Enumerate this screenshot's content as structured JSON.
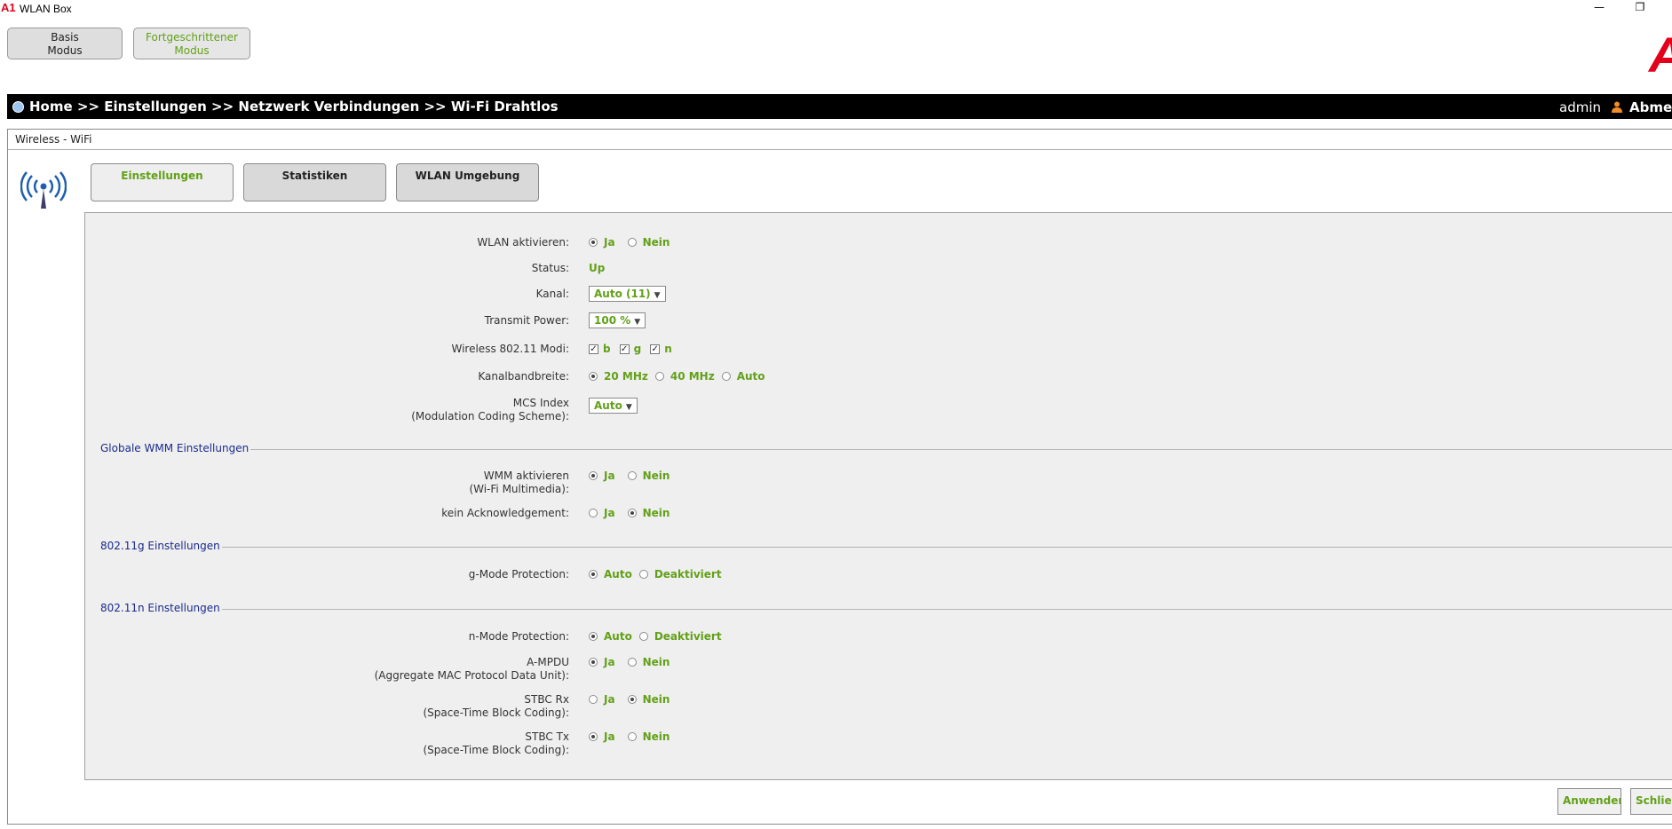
{
  "window": {
    "logo": "A1",
    "title": "WLAN Box",
    "minimize": "—",
    "restore": "❐"
  },
  "modes": {
    "basic_line1": "Basis",
    "basic_line2": "Modus",
    "advanced_line1": "Fortgeschrittener",
    "advanced_line2": "Modus"
  },
  "brand": "A",
  "breadcrumb": {
    "path": "Home >> Einstellungen >> Netzwerk Verbindungen >> Wi-Fi Drahtlos",
    "user": "admin",
    "logout": "Abmeld"
  },
  "panel_title": "Wireless - WiFi",
  "tabs": {
    "settings": "Einstellungen",
    "statistics": "Statistiken",
    "environment": "WLAN Umgebung"
  },
  "form": {
    "wlan_enable": {
      "label": "WLAN aktivieren:",
      "yes": "Ja",
      "no": "Nein",
      "selected": "yes"
    },
    "status": {
      "label": "Status:",
      "value": "Up"
    },
    "channel": {
      "label": "Kanal:",
      "value": "Auto (11)"
    },
    "transmit_power": {
      "label": "Transmit Power:",
      "value": "100 %"
    },
    "modes": {
      "label": "Wireless 802.11 Modi:",
      "b": "b",
      "g": "g",
      "n": "n",
      "b_checked": true,
      "g_checked": true,
      "n_checked": true
    },
    "bandwidth": {
      "label": "Kanalbandbreite:",
      "opt1": "20 MHz",
      "opt2": "40 MHz",
      "opt3": "Auto",
      "selected": "20 MHz"
    },
    "mcs": {
      "label1": "MCS Index",
      "label2": "(Modulation Coding Scheme):",
      "value": "Auto"
    },
    "wmm_section": "Globale WMM Einstellungen",
    "wmm_enable": {
      "label1": "WMM aktivieren",
      "label2": "(Wi-Fi Multimedia):",
      "yes": "Ja",
      "no": "Nein",
      "selected": "yes"
    },
    "no_ack": {
      "label": "kein Acknowledgement:",
      "yes": "Ja",
      "no": "Nein",
      "selected": "no"
    },
    "g_section": "802.11g Einstellungen",
    "g_protection": {
      "label": "g-Mode Protection:",
      "auto": "Auto",
      "off": "Deaktiviert",
      "selected": "auto"
    },
    "n_section": "802.11n Einstellungen",
    "n_protection": {
      "label": "n-Mode Protection:",
      "auto": "Auto",
      "off": "Deaktiviert",
      "selected": "auto"
    },
    "ampdu": {
      "label1": "A-MPDU",
      "label2": "(Aggregate MAC Protocol Data Unit):",
      "yes": "Ja",
      "no": "Nein",
      "selected": "yes"
    },
    "stbc_rx": {
      "label1": "STBC Rx",
      "label2": "(Space-Time Block Coding):",
      "yes": "Ja",
      "no": "Nein",
      "selected": "no"
    },
    "stbc_tx": {
      "label1": "STBC Tx",
      "label2": "(Space-Time Block Coding):",
      "yes": "Ja",
      "no": "Nein",
      "selected": "yes"
    }
  },
  "actions": {
    "apply": "Anwenden",
    "close": "Schließen"
  },
  "colors": {
    "accent_green": "#62a018",
    "section_blue": "#1a2a8c",
    "brand_red": "#e2001a"
  }
}
